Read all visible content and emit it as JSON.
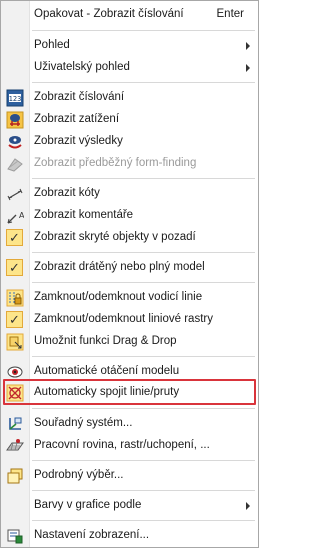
{
  "menu": {
    "repeat": {
      "label": "Opakovat - Zobrazit číslování",
      "shortcut": "Enter"
    },
    "pohled": "Pohled",
    "user_view": "Uživatelský pohled",
    "show_numbering": "Zobrazit číslování",
    "show_loads": "Zobrazit zatížení",
    "show_results": "Zobrazit výsledky",
    "show_form_finding": "Zobrazit předběžný form-finding",
    "show_dimensions": "Zobrazit kóty",
    "show_comments": "Zobrazit komentáře",
    "show_hidden": "Zobrazit skryté objekty v pozadí",
    "show_wireframe": "Zobrazit drátěný nebo plný model",
    "lock_guides": "Zamknout/odemknout vodicí linie",
    "lock_grids": "Zamknout/odemknout liniové rastry",
    "drag_drop": "Umožnit funkci Drag & Drop",
    "auto_rotate": "Automatické otáčení modelu",
    "auto_connect": "Automaticky spojit linie/pruty",
    "coord_system": "Souřadný systém...",
    "work_plane": "Pracovní rovina, rastr/uchopení, ...",
    "detail_select": "Podrobný výběr...",
    "colors": "Barvy v grafice podle",
    "display_settings": "Nastavení zobrazení..."
  },
  "icons": {
    "numbering": "numbering-icon",
    "loads": "loads-icon",
    "results": "results-icon",
    "form_finding": "form-finding-icon",
    "dimensions": "dimension-icon",
    "comments": "comment-icon",
    "check": "checkmark-icon",
    "lock_guides": "lock-guides-icon",
    "drag_drop": "drag-drop-icon",
    "rotate": "eye-rotate-icon",
    "connect": "connect-lines-icon",
    "coord": "coordinate-system-icon",
    "work_plane": "work-plane-icon",
    "detail_select": "select-window-icon",
    "display_settings": "display-settings-icon"
  },
  "check_glyph": "✓",
  "colors": {
    "highlight_border": "#d9343b",
    "check_bg": "#fde58a",
    "check_border": "#e3a93a"
  }
}
